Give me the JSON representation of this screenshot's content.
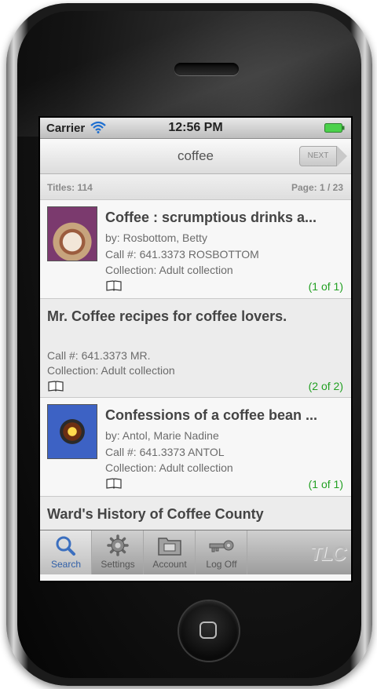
{
  "status_bar": {
    "carrier": "Carrier",
    "time": "12:56 PM"
  },
  "nav": {
    "title": "coffee",
    "next_label": "NEXT"
  },
  "info": {
    "titles": "Titles: 114",
    "page": "Page: 1 / 23"
  },
  "results": [
    {
      "title": "Coffee : scrumptious drinks a...",
      "author": "by: Rosbottom, Betty",
      "call": "Call #: 641.3373 ROSBOTTOM",
      "collection": "Collection: Adult collection",
      "holdings": "(1 of 1)",
      "format_icon": "book-icon"
    },
    {
      "title": "Mr. Coffee recipes for coffee lovers.",
      "call": "Call #: 641.3373 MR.",
      "collection": "Collection: Adult collection",
      "holdings": "(2 of 2)",
      "format_icon": "book-icon"
    },
    {
      "title": "Confessions of a coffee bean ...",
      "author": "by: Antol, Marie Nadine",
      "call": "Call #: 641.3373 ANTOL",
      "collection": "Collection: Adult collection",
      "holdings": "(1 of 1)",
      "format_icon": "book-icon"
    },
    {
      "title": "Ward's History of Coffee County"
    }
  ],
  "tabs": [
    {
      "label": "Search",
      "icon": "magnifier-icon",
      "active": true
    },
    {
      "label": "Settings",
      "icon": "gear-icon"
    },
    {
      "label": "Account",
      "icon": "folder-icon"
    },
    {
      "label": "Log Off",
      "icon": "key-icon"
    }
  ],
  "brand": {
    "logo_text": "TLC"
  },
  "colors": {
    "holdings_green": "#22a022",
    "active_tab_blue": "#2f5fa8"
  }
}
